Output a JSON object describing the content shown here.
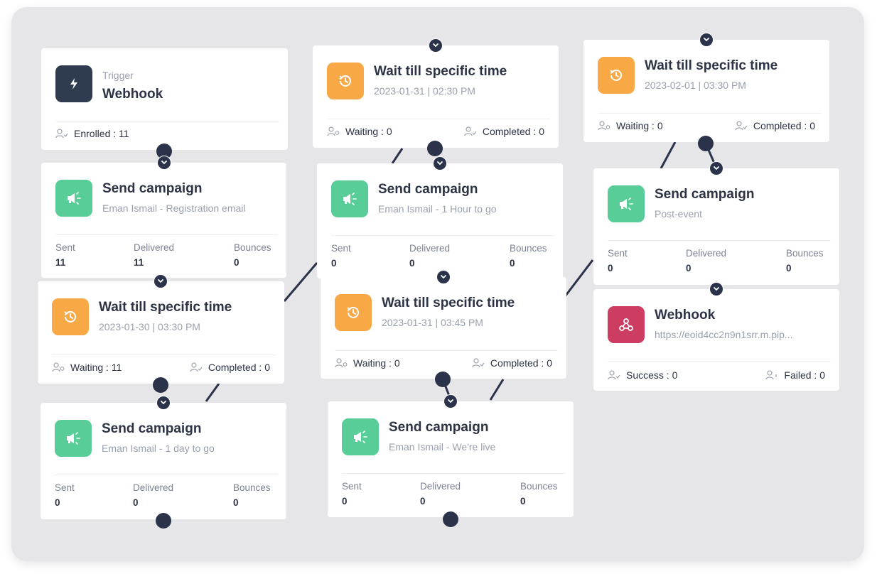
{
  "colors": {
    "trigger_icon": "#2f3b4f",
    "campaign_icon": "#58cd98",
    "wait_icon": "#f8a945",
    "webhook_icon": "#cd3c61",
    "connector": "#2a3349",
    "canvas_bg": "#e6e6e9"
  },
  "trigger": {
    "kicker": "Trigger",
    "title": "Webhook",
    "icon": "lightning-icon",
    "enrolled": "Enrolled : 11"
  },
  "metric_labels": {
    "sent": "Sent",
    "delivered": "Delivered",
    "bounces": "Bounces"
  },
  "nodes": [
    {
      "type": "campaign",
      "title": "Send campaign",
      "subtitle": "Eman Ismail - Registration email",
      "sent": "11",
      "delivered": "11",
      "bounces": "0"
    },
    {
      "type": "wait",
      "title": "Wait till specific time",
      "subtitle": "2023-01-30 | 03:30 PM",
      "waiting": "Waiting : 11",
      "completed": "Completed : 0"
    },
    {
      "type": "campaign",
      "title": "Send campaign",
      "subtitle": "Eman Ismail - 1 day to go",
      "sent": "0",
      "delivered": "0",
      "bounces": "0"
    },
    {
      "type": "wait",
      "title": "Wait till specific time",
      "subtitle": "2023-01-31 | 02:30 PM",
      "waiting": "Waiting : 0",
      "completed": "Completed : 0"
    },
    {
      "type": "campaign",
      "title": "Send campaign",
      "subtitle": "Eman Ismail - 1 Hour to go",
      "sent": "0",
      "delivered": "0",
      "bounces": "0"
    },
    {
      "type": "wait",
      "title": "Wait till specific time",
      "subtitle": "2023-01-31 | 03:45 PM",
      "waiting": "Waiting : 0",
      "completed": "Completed : 0"
    },
    {
      "type": "campaign",
      "title": "Send campaign",
      "subtitle": "Eman Ismail - We're live",
      "sent": "0",
      "delivered": "0",
      "bounces": "0"
    },
    {
      "type": "wait",
      "title": "Wait till specific time",
      "subtitle": "2023-02-01 | 03:30 PM",
      "waiting": "Waiting : 0",
      "completed": "Completed : 0"
    },
    {
      "type": "campaign",
      "title": "Send campaign",
      "subtitle": "Post-event",
      "sent": "0",
      "delivered": "0",
      "bounces": "0"
    },
    {
      "type": "webhook",
      "title": "Webhook",
      "subtitle": "https://eoid4cc2n9n1srr.m.pip...",
      "success": "Success : 0",
      "failed": "Failed : 0"
    }
  ]
}
